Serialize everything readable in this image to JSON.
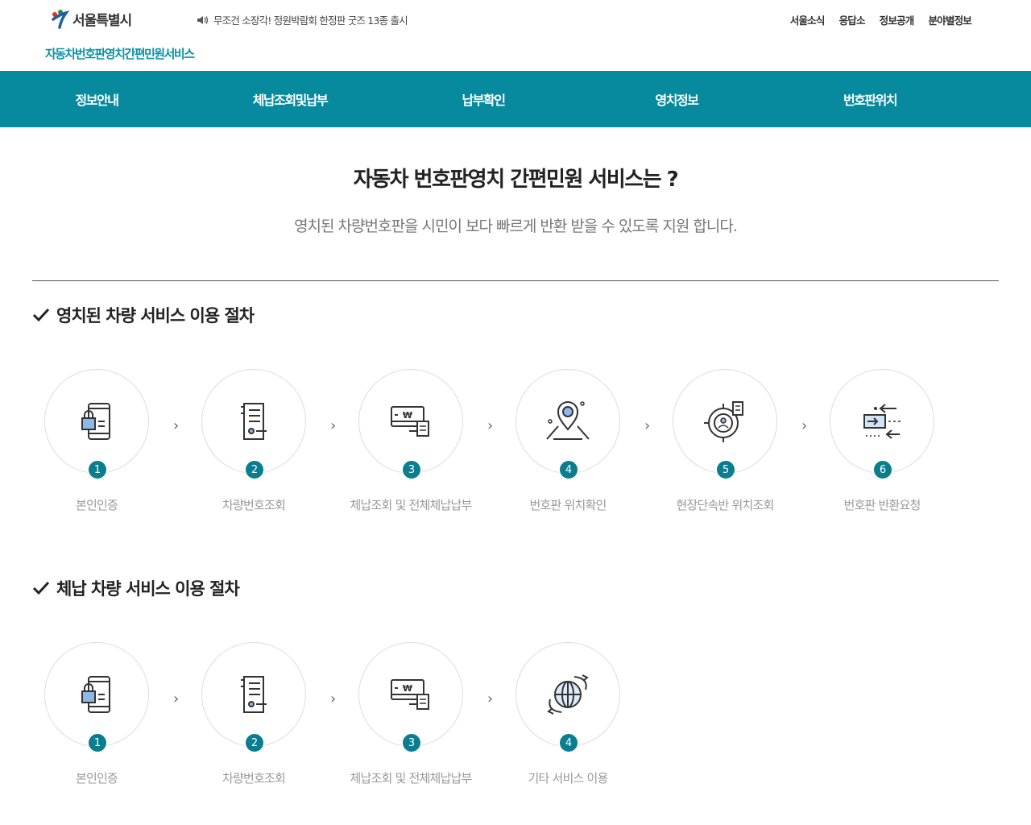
{
  "header": {
    "logo_text": "서울특별시",
    "subtitle": "자동차번호판영치간편민원서비스",
    "notice": "무조건 소장각! 정원박람회 한정판 굿즈 13종 출시",
    "util_links": [
      "서울소식",
      "응답소",
      "정보공개",
      "분야별정보"
    ]
  },
  "nav": [
    "정보안내",
    "체납조회및납부",
    "납부확인",
    "영치정보",
    "번호판위치"
  ],
  "intro": {
    "title": "자동차 번호판영치 간편민원 서비스는 ?",
    "desc": "영치된 차량번호판을 시민이 보다 빠르게 반환 받을 수 있도록 지원 합니다."
  },
  "sections": [
    {
      "title": "영치된 차량 서비스 이용 절차",
      "steps": [
        {
          "num": "1",
          "label": "본인인증",
          "icon": "phone-lock-icon"
        },
        {
          "num": "2",
          "label": "차량번호조회",
          "icon": "document-list-icon"
        },
        {
          "num": "3",
          "label": "체납조회 및 전체체납납부",
          "icon": "payment-icon"
        },
        {
          "num": "4",
          "label": "번호판 위치확인",
          "icon": "map-pin-icon"
        },
        {
          "num": "5",
          "label": "현장단속반 위치조회",
          "icon": "target-person-icon"
        },
        {
          "num": "6",
          "label": "번호판 반환요청",
          "icon": "return-arrows-icon"
        }
      ]
    },
    {
      "title": "체납 차량 서비스 이용 절차",
      "steps": [
        {
          "num": "1",
          "label": "본인인증",
          "icon": "phone-lock-icon"
        },
        {
          "num": "2",
          "label": "차량번호조회",
          "icon": "document-list-icon"
        },
        {
          "num": "3",
          "label": "체납조회 및 전체체납납부",
          "icon": "payment-icon"
        },
        {
          "num": "4",
          "label": "기타 서비스 이용",
          "icon": "globe-icon"
        }
      ]
    }
  ],
  "colors": {
    "accent": "#078a9e",
    "badge": "#0a7e8f"
  }
}
